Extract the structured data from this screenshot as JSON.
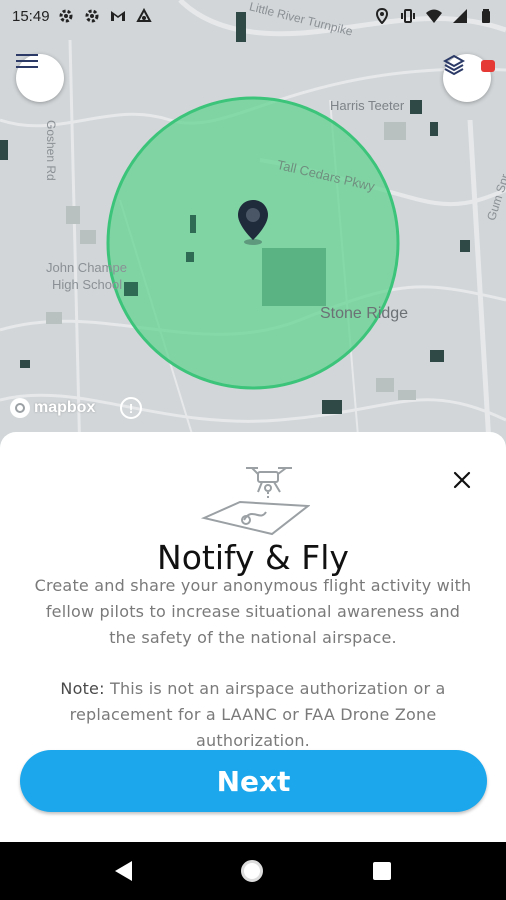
{
  "status_bar": {
    "time": "15:49",
    "left_icons": [
      "gear-icon",
      "gear-icon",
      "gmail-icon",
      "link-icon"
    ],
    "right_icons": [
      "location-icon",
      "vibrate-icon",
      "wifi-icon",
      "signal-icon",
      "battery-icon"
    ]
  },
  "map": {
    "labels": {
      "turnpike": "Little River Turnpike",
      "goshen": "Goshen Rd",
      "harris": "Harris Teeter",
      "tall_cedars": "Tall Cedars Pkwy",
      "john_champe_1": "John Champe",
      "john_champe_2": "High School",
      "stone_ridge": "Stone Ridge",
      "gum_spring": "Gum Spr"
    },
    "attribution": "mapbox",
    "info": "!",
    "colors": {
      "radius_fill": "#5fd38f",
      "pin": "#1f2a3a"
    }
  },
  "sheet": {
    "title": "Notify & Fly",
    "description": "Create and share your anonymous flight activity with fellow pilots to increase situational awareness and the safety of the national airspace.",
    "note_label": "Note:",
    "note_text": " This is not an airspace authorization or a replacement for a LAANC or FAA Drone Zone authorization.",
    "next_label": "Next",
    "colors": {
      "next_button": "#1ca7ec"
    }
  }
}
